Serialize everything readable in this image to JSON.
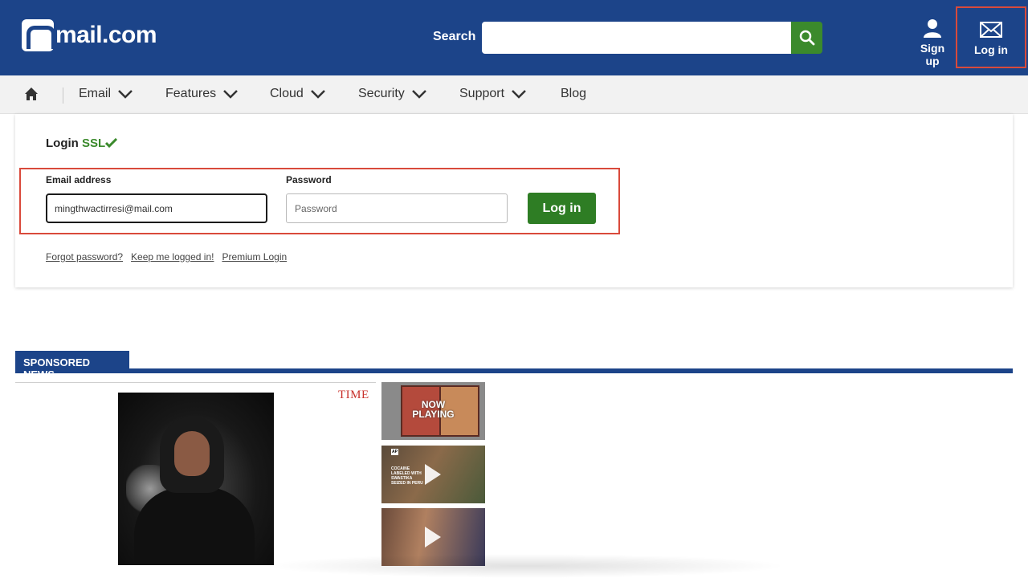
{
  "header": {
    "logo_text": "mail.com",
    "search_label": "Search",
    "search_placeholder": "",
    "signup_label": "Sign up",
    "login_label": "Log in",
    "colors": {
      "brand_blue": "#1c4489",
      "accent_green": "#3b8a2c",
      "highlight_red": "#d94a3b"
    }
  },
  "nav": {
    "items": [
      {
        "label": "Email"
      },
      {
        "label": "Features"
      },
      {
        "label": "Cloud"
      },
      {
        "label": "Security"
      },
      {
        "label": "Support"
      },
      {
        "label": "Blog"
      }
    ]
  },
  "login": {
    "title": "Login",
    "ssl": "SSL",
    "email_label": "Email address",
    "email_value": "mingthwactirresi@mail.com",
    "password_label": "Password",
    "password_placeholder": "Password",
    "submit_label": "Log in",
    "links": [
      "Forgot password?",
      "Keep me logged in!",
      "Premium Login"
    ]
  },
  "sponsored": {
    "heading": "SPONSORED NEWS",
    "source_logo": "TIME",
    "thumbs": [
      {
        "overlay": "NOW\nPLAYING",
        "icon": "now-playing"
      },
      {
        "caption": "COCAINE LABELED WITH SWASTIKA SEIZED IN PERU",
        "badge": "AP",
        "icon": "play-icon"
      },
      {
        "icon": "play-icon"
      }
    ]
  }
}
